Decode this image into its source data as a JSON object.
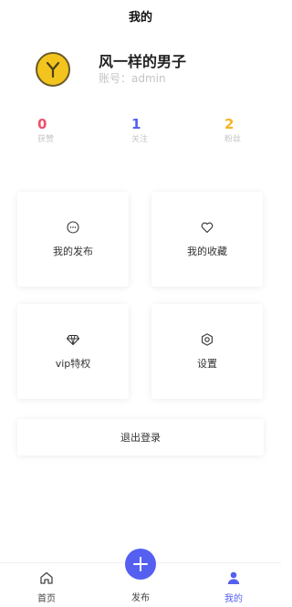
{
  "header": {
    "title": "我的"
  },
  "user": {
    "name": "风一样的男子",
    "account": "账号：admin"
  },
  "stats": [
    {
      "value": "0",
      "label": "获赞",
      "color": "#f0506a"
    },
    {
      "value": "1",
      "label": "关注",
      "color": "#5560f0"
    },
    {
      "value": "2",
      "label": "粉丝",
      "color": "#f5b525"
    }
  ],
  "menu": [
    {
      "label": "我的发布",
      "icon": "comment-icon"
    },
    {
      "label": "我的收藏",
      "icon": "heart-icon"
    },
    {
      "label": "vip特权",
      "icon": "diamond-icon"
    },
    {
      "label": "设置",
      "icon": "settings-icon"
    }
  ],
  "logout": {
    "label": "退出登录"
  },
  "tabbar": {
    "home": "首页",
    "publish": "发布",
    "mine": "我的",
    "active_color": "#5560f0"
  }
}
